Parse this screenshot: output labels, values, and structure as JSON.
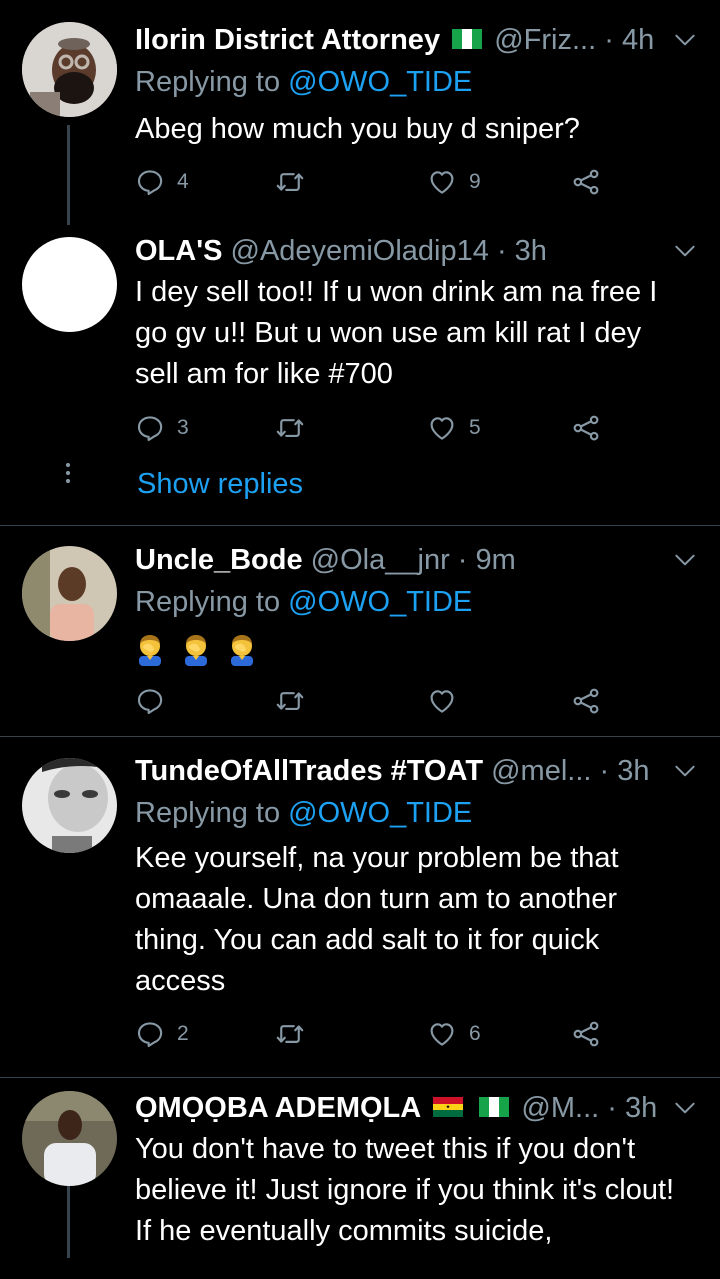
{
  "tweets": [
    {
      "name": "Ilorin District Attorney",
      "handle": "@Friz...",
      "time": "4h",
      "replying_label": "Replying to",
      "replying_to": "@OWO_TIDE",
      "text": "Abeg how much you buy d sniper?",
      "replies": "4",
      "retweets": "",
      "likes": "9"
    },
    {
      "name": "OLA'S",
      "handle": "@AdeyemiOladip14",
      "time": "3h",
      "text": "I dey sell too!! If u won drink am na free I go gv u!! But u won use am kill rat I dey sell am for like #700",
      "replies": "3",
      "retweets": "",
      "likes": "5",
      "show_replies": "Show replies"
    },
    {
      "name": "Uncle_Bode",
      "handle": "@Ola__jnr",
      "time": "9m",
      "replying_label": "Replying to",
      "replying_to": "@OWO_TIDE",
      "replies": "",
      "retweets": "",
      "likes": ""
    },
    {
      "name": "TundeOfAllTrades #TOAT",
      "handle": "@mel...",
      "time": "3h",
      "replying_label": "Replying to",
      "replying_to": "@OWO_TIDE",
      "text": "Kee yourself, na your problem be that omaaale. Una don turn am to another thing. You can add salt to it for quick access",
      "replies": "2",
      "retweets": "",
      "likes": "6"
    },
    {
      "name": "ỌMỌỌBA ADEMỌLA",
      "handle": "@M...",
      "time": "3h",
      "text": "You don't have to tweet this if you don't believe it! Just ignore if you think it's clout! If he eventually commits suicide,"
    }
  ],
  "separator": "·",
  "colors": {
    "background": "#000000",
    "text": "#ffffff",
    "secondary": "#8899a6",
    "accent": "#1da1f2",
    "divider": "#38444d"
  },
  "icons": [
    "reply-icon",
    "retweet-icon",
    "like-icon",
    "share-icon",
    "chevron-down-icon",
    "flag-nigeria-icon",
    "flag-ghana-icon",
    "facepalm-emoji"
  ]
}
